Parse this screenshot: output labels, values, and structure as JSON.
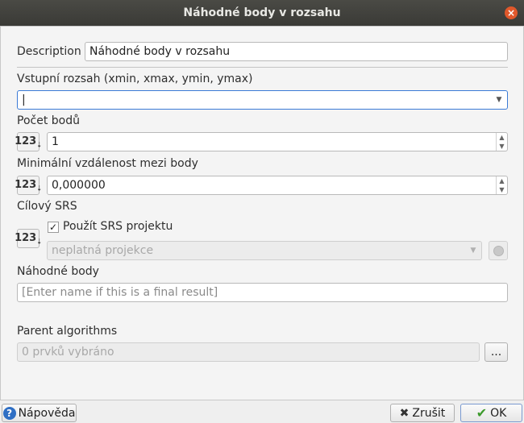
{
  "window": {
    "title": "Náhodné body v rozsahu",
    "close_glyph": "×"
  },
  "description": {
    "label": "Description",
    "value": "Náhodné body v rozsahu"
  },
  "extent": {
    "label": "Vstupní rozsah (xmin, xmax, ymin, ymax)",
    "value": "|"
  },
  "point_count": {
    "label": "Počet bodů",
    "value": "1"
  },
  "min_distance": {
    "label": "Minimální vzdálenost mezi body",
    "value": "0,000000"
  },
  "target_srs": {
    "label": "Cílový SRS",
    "use_project_label": "Použít SRS projektu",
    "checked_glyph": "✓",
    "projection": "neplatná projekce"
  },
  "output": {
    "label": "Náhodné body",
    "placeholder": "[Enter name if this is a final result]"
  },
  "parent": {
    "label": "Parent algorithms",
    "value": "0 prvků vybráno",
    "browse_label": "..."
  },
  "numeric_button": {
    "main": "123",
    "sub": "⇣"
  },
  "footer": {
    "help_label": "Nápověda",
    "cancel_label": "Zrušit",
    "ok_label": "OK",
    "help_glyph": "?",
    "cancel_glyph": "✖",
    "ok_glyph": "✔"
  },
  "colors": {
    "accent": "#3a7ad6",
    "close": "#e0582b",
    "title_bg": "#3f3f3b"
  }
}
